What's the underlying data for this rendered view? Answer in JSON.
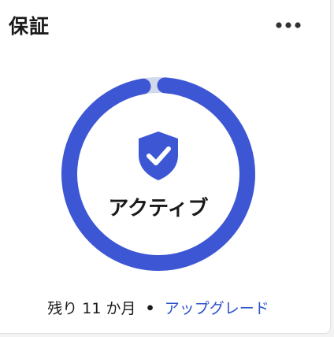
{
  "card": {
    "title": "保証",
    "status": "アクティブ",
    "remaining": "残り 11 か月",
    "separator": "•",
    "upgrade_label": "アップグレード",
    "progress_fraction": 0.96,
    "icons": {
      "more": "more-horizontal-icon",
      "shield": "shield-check-icon"
    }
  },
  "colors": {
    "accent": "#3d57d4",
    "track": "#d3d9ec",
    "link": "#2c52c8"
  }
}
